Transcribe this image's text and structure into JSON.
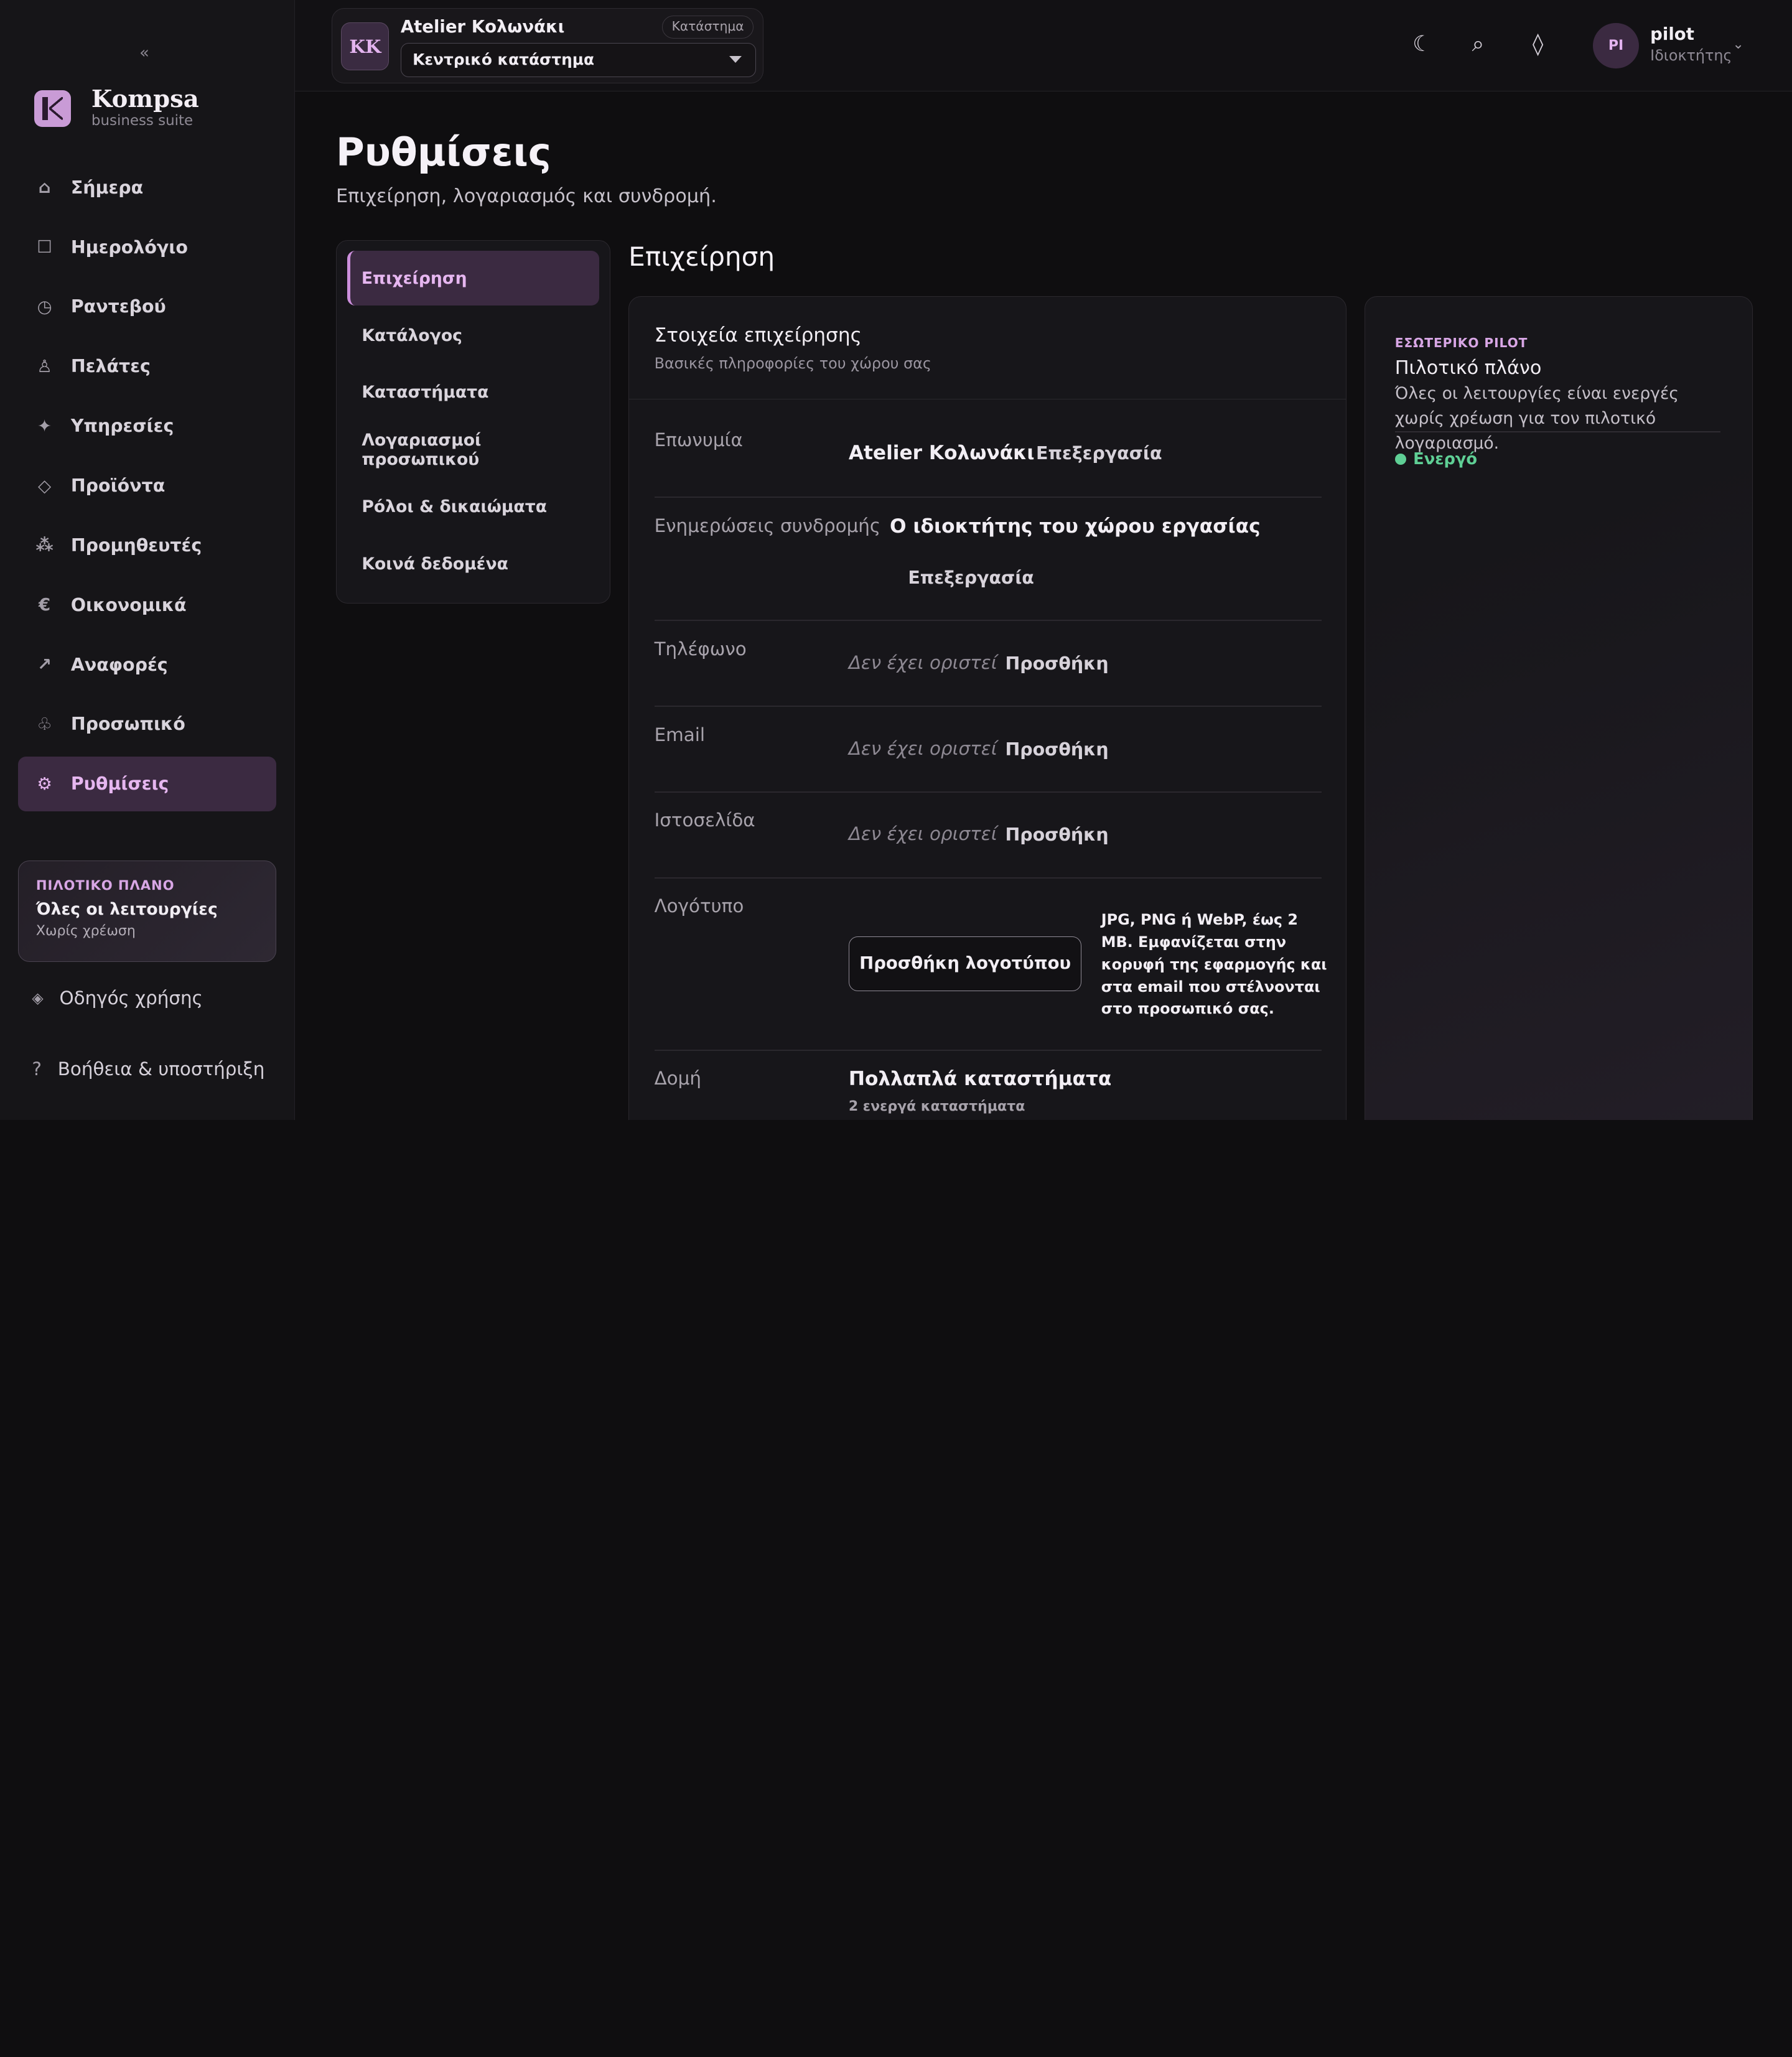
{
  "app": {
    "name": "Kompsa",
    "tagline": "business suite",
    "collapse_icon": "«"
  },
  "sidebar": {
    "items": [
      {
        "label": "Σήμερα",
        "icon": "home-icon",
        "glyph": "⌂"
      },
      {
        "label": "Ημερολόγιο",
        "icon": "calendar-icon",
        "glyph": "☐"
      },
      {
        "label": "Ραντεβού",
        "icon": "clock-icon",
        "glyph": "◷"
      },
      {
        "label": "Πελάτες",
        "icon": "person-icon",
        "glyph": "♙"
      },
      {
        "label": "Υπηρεσίες",
        "icon": "sparkle-icon",
        "glyph": "✦"
      },
      {
        "label": "Προϊόντα",
        "icon": "diamond-icon",
        "glyph": "◇"
      },
      {
        "label": "Προμηθευτές",
        "icon": "dots-icon",
        "glyph": "⁂"
      },
      {
        "label": "Οικονομικά",
        "icon": "euro-icon",
        "glyph": "€"
      },
      {
        "label": "Αναφορές",
        "icon": "trend-arrow-icon",
        "glyph": "↗"
      },
      {
        "label": "Προσωπικό",
        "icon": "staff-icon",
        "glyph": "♧"
      },
      {
        "label": "Ρυθμίσεις",
        "icon": "gear-icon",
        "glyph": "⚙"
      }
    ],
    "active_index": 10,
    "pilot_card": {
      "tag": "ΠΙΛΟΤΙΚΟ ΠΛΑΝΟ",
      "title": "Όλες οι λειτουργίες",
      "subtitle": "Χωρίς χρέωση"
    },
    "guide": {
      "label": "Οδηγός χρήσης",
      "glyph": "◈"
    },
    "help": {
      "label": "Βοήθεια & υποστήριξη",
      "glyph": "?"
    }
  },
  "topbar": {
    "store_initials": "KK",
    "store_name": "Atelier Κολωνάκι",
    "store_badge": "Κατάστημα",
    "store_select": "Κεντρικό κατάστημα",
    "icons": {
      "theme": "☾",
      "search": "⌕",
      "diamond": "◊"
    },
    "user_initials": "PI",
    "user_name": "pilot",
    "user_role": "Ιδιοκτήτης",
    "user_chevron": "⌄"
  },
  "page": {
    "title": "Ρυθμίσεις",
    "subtitle": "Επιχείρηση, λογαριασμός και συνδρομή."
  },
  "subnav": {
    "items": [
      "Επιχείρηση",
      "Κατάλογος",
      "Καταστήματα",
      "Λογαριασμοί προσωπικού",
      "Ρόλοι & δικαιώματα",
      "Κοινά δεδομένα"
    ],
    "active_index": 0
  },
  "section": {
    "title": "Επιχείρηση",
    "card": {
      "title": "Στοιχεία επιχείρησης",
      "subtitle": "Βασικές πληροφορίες του χώρου σας",
      "rows": {
        "name": {
          "label": "Επωνυμία",
          "value": "Atelier Κολωνάκι",
          "action": "Επεξεργασία"
        },
        "updates": {
          "label": "Ενημερώσεις συνδρομής",
          "value": "Ο ιδιοκτήτης του χώρου εργασίας",
          "action": "Επεξεργασία"
        },
        "phone": {
          "label": "Τηλέφωνο",
          "value": "Δεν έχει οριστεί",
          "action": "Προσθήκη"
        },
        "email": {
          "label": "Email",
          "value": "Δεν έχει οριστεί",
          "action": "Προσθήκη"
        },
        "website": {
          "label": "Ιστοσελίδα",
          "value": "Δεν έχει οριστεί",
          "action": "Προσθήκη"
        },
        "logo": {
          "label": "Λογότυπο",
          "button": "Προσθήκη λογοτύπου",
          "help": "JPG, PNG ή WebP, έως 2 MB. Εμφανίζεται στην κορυφή της εφαρμογής και στα email που στέλνονται στο προσωπικό σας."
        },
        "structure": {
          "label": "Δομή",
          "value": "Πολλαπλά καταστήματα",
          "detail": "2 ενεργά καταστήματα"
        }
      }
    }
  },
  "plan_card": {
    "tag": "ΕΣΩΤΕΡΙΚΟ PILOT",
    "title": "Πιλοτικό πλάνο",
    "description": "Όλες οι λειτουργίες είναι ενεργές χωρίς χρέωση για τον πιλοτικό λογαριασμό.",
    "status": "Ενεργό",
    "status_color": "#5fcf95"
  },
  "colors": {
    "accent": "#e6b6f0",
    "active_bg": "#3b2a41",
    "background": "#0f0e10"
  }
}
